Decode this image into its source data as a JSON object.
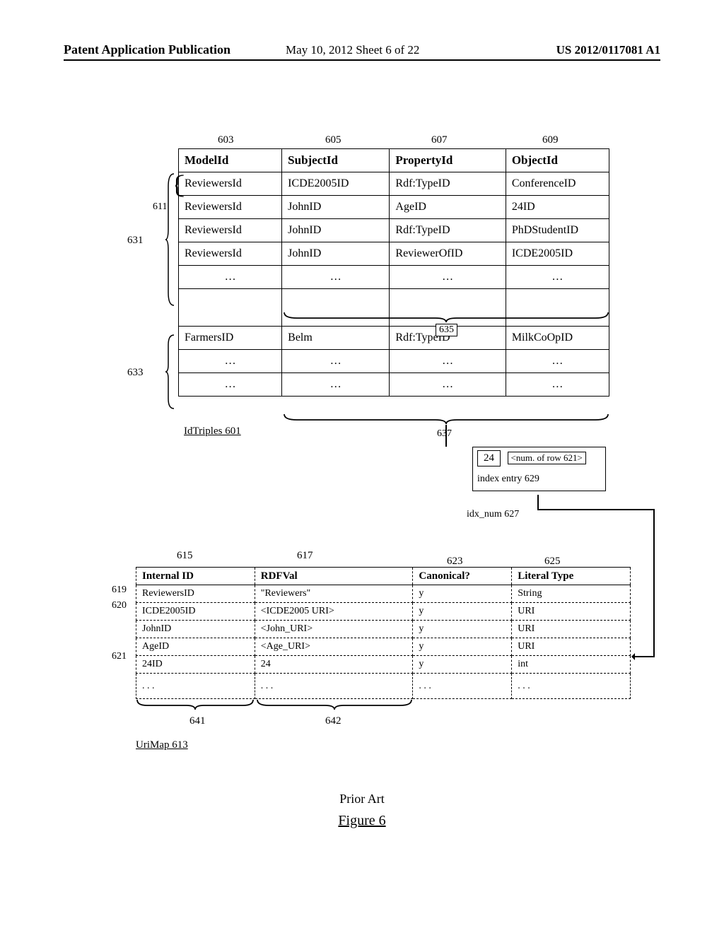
{
  "header": {
    "pap": "Patent Application Publication",
    "date": "May 10, 2012  Sheet 6 of 22",
    "pubno": "US 2012/0117081 A1"
  },
  "colnums": {
    "c1": "603",
    "c2": "605",
    "c3": "607",
    "c4": "609"
  },
  "triples": {
    "headers": [
      "ModelId",
      "SubjectId",
      "PropertyId",
      "ObjectId"
    ],
    "rows_a": [
      [
        "ReviewersId",
        "ICDE2005ID",
        "Rdf:TypeID",
        "ConferenceID"
      ],
      [
        "ReviewersId",
        "JohnID",
        "AgeID",
        "24ID"
      ],
      [
        "ReviewersId",
        "JohnID",
        "Rdf:TypeID",
        "PhDStudentID"
      ],
      [
        "ReviewersId",
        "JohnID",
        "ReviewerOfID",
        "ICDE2005ID"
      ],
      [
        "…",
        "…",
        "…",
        "…"
      ]
    ],
    "rows_b": [
      [
        "FarmersID",
        "Belm",
        "Rdf:TypeID",
        "MilkCoOpID"
      ],
      [
        "…",
        "…",
        "…",
        "…"
      ],
      [
        "…",
        "…",
        "…",
        "…"
      ]
    ]
  },
  "labels": {
    "r631": "631",
    "r611": "611",
    "r633": "633",
    "r635": "635",
    "r637": "637",
    "idtriples": "IdTriples 601",
    "idxentry": "index entry 629",
    "idxnum": "idx_num 627",
    "idxval": "24",
    "idxrow": "<num. of row 621>",
    "u615": "615",
    "u617": "617",
    "u623": "623",
    "u625": "625",
    "u619": "619",
    "u620": "620",
    "u621": "621",
    "u641": "641",
    "u642": "642",
    "urimap": "UriMap 613",
    "priorart": "Prior Art",
    "figure": "Figure 6"
  },
  "urimap": {
    "headers": [
      "Internal ID",
      "RDFVal",
      "Canonical?",
      "Literal Type"
    ],
    "rows": [
      [
        "ReviewersID",
        "\"Reviewers\"",
        "y",
        "String"
      ],
      [
        "ICDE2005ID",
        "<ICDE2005 URI>",
        "y",
        "URI"
      ],
      [
        "JohnID",
        "<John_URI>",
        "y",
        "URI"
      ],
      [
        "AgeID",
        "<Age_URI>",
        "y",
        "URI"
      ],
      [
        "24ID",
        "24",
        "y",
        "int"
      ],
      [
        ". . .",
        ". . .",
        ". . .",
        ". . ."
      ]
    ]
  }
}
